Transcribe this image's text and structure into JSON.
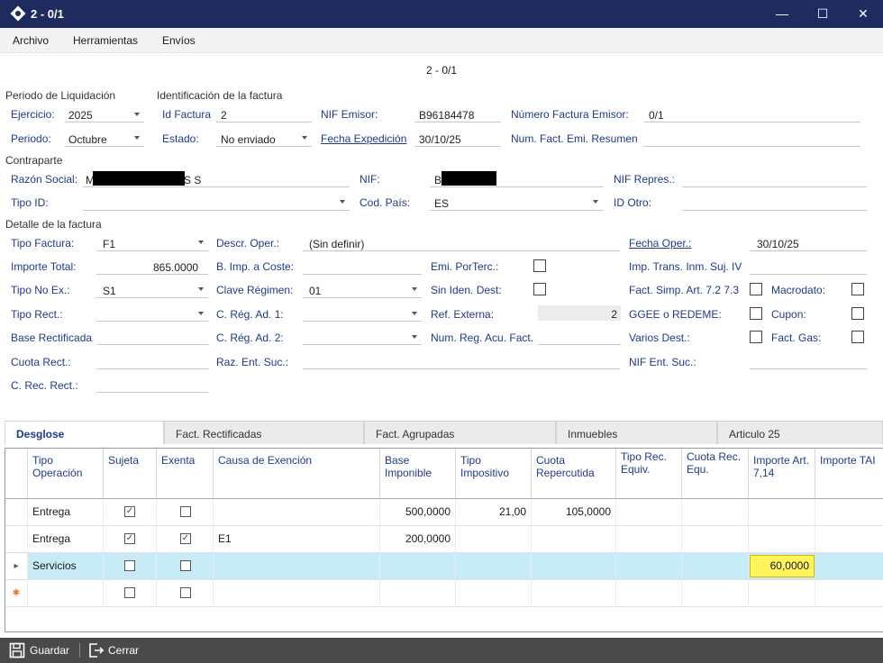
{
  "window": {
    "title": "2 - 0/1",
    "minimize": "—",
    "maximize": "☐",
    "close": "✕"
  },
  "menu": [
    "Archivo",
    "Herramientas",
    "Envíos"
  ],
  "form": {
    "header": "2 - 0/1",
    "sections": {
      "periodo": "Periodo de Liquidación",
      "identificacion": "Identificación de la factura",
      "contraparte": "Contraparte",
      "detalle": "Detalle de la factura"
    },
    "ejercicio": {
      "label": "Ejercicio:",
      "value": "2025"
    },
    "periodo": {
      "label": "Periodo:",
      "value": "Octubre"
    },
    "id_factura": {
      "label": "Id Factura",
      "value": "2"
    },
    "estado": {
      "label": "Estado:",
      "value": "No enviado"
    },
    "nif_emisor": {
      "label": "NIF Emisor:",
      "value": "B96184478"
    },
    "fecha_expedicion": {
      "label": "Fecha Expedición",
      "value": "30/10/25"
    },
    "numero_factura": {
      "label": "Número Factura Emisor:",
      "value": "0/1"
    },
    "num_fact_resumen": {
      "label": "Num. Fact. Emi. Resumen",
      "value": ""
    },
    "razon_social": {
      "label": "Razón Social:",
      "value_start": "M",
      "value_end": "S S"
    },
    "nif": {
      "label": "NIF:",
      "value": "B"
    },
    "nif_repres": {
      "label": "NIF Repres.:",
      "value": ""
    },
    "tipo_id": {
      "label": "Tipo ID:",
      "value": ""
    },
    "cod_pais": {
      "label": "Cod. País:",
      "value": "ES"
    },
    "id_otro": {
      "label": "ID Otro:",
      "value": ""
    },
    "tipo_factura": {
      "label": "Tipo Factura:",
      "value": "F1"
    },
    "descr_oper": {
      "label": "Descr. Oper.:",
      "value": "(Sin definir)"
    },
    "fecha_oper": {
      "label": "Fecha Oper.:",
      "value": "30/10/25"
    },
    "importe_total": {
      "label": "Importe Total:",
      "value": "865.0000"
    },
    "b_imp_coste": {
      "label": "B. Imp. a Coste:",
      "value": ""
    },
    "emi_porterc": {
      "label": "Emi. PorTerc.:"
    },
    "imp_trans": {
      "label": "Imp. Trans. Inm. Suj. IV",
      "value": ""
    },
    "tipo_no_ex": {
      "label": "Tipo No Ex.:",
      "value": "S1"
    },
    "clave_regimen": {
      "label": "Clave Régimen:",
      "value": "01"
    },
    "sin_iden_dest": {
      "label": "Sin Iden. Dest:"
    },
    "fact_simp": {
      "label": "Fact. Simp. Art. 7.2 7.3"
    },
    "macrodato": {
      "label": "Macrodato:"
    },
    "tipo_rect": {
      "label": "Tipo Rect.:",
      "value": ""
    },
    "c_reg_ad1": {
      "label": "C. Rég. Ad. 1:",
      "value": ""
    },
    "ref_externa": {
      "label": "Ref. Externa:",
      "value": "2"
    },
    "ggee": {
      "label": "GGEE o REDEME:"
    },
    "cupon": {
      "label": "Cupon:"
    },
    "base_rectificada": {
      "label": "Base Rectificada",
      "value": ""
    },
    "c_reg_ad2": {
      "label": "C. Rég. Ad. 2:",
      "value": ""
    },
    "num_reg_acu": {
      "label": "Num. Reg. Acu. Fact.",
      "value": ""
    },
    "varios_dest": {
      "label": "Varios Dest.:"
    },
    "fact_gas": {
      "label": "Fact. Gas:"
    },
    "cuota_rect": {
      "label": "Cuota Rect.:",
      "value": ""
    },
    "raz_ent_suc": {
      "label": "Raz. Ent. Suc.:",
      "value": ""
    },
    "nif_ent_suc": {
      "label": "NIF Ent. Suc.:",
      "value": ""
    },
    "c_rec_rect": {
      "label": "C. Rec. Rect.:",
      "value": ""
    }
  },
  "tabs": [
    "Desglose",
    "Fact. Rectificadas",
    "Fact. Agrupadas",
    "Inmuebles",
    "Articulo 25"
  ],
  "grid": {
    "columns": [
      "Tipo Operación",
      "Sujeta",
      "Exenta",
      "Causa de Exención",
      "Base Imponible",
      "Tipo Impositivo",
      "Cuota Repercutida",
      "Tipo Rec. Equiv.",
      "Cuota Rec. Equ.",
      "Importe Art. 7,14",
      "Importe TAI"
    ],
    "rows": [
      {
        "tipo": "Entrega",
        "sujeta": true,
        "exenta": false,
        "causa": "",
        "base": "500,0000",
        "tipo_imp": "21,00",
        "cuota": "105,0000",
        "importe714": ""
      },
      {
        "tipo": "Entrega",
        "sujeta": true,
        "exenta": true,
        "causa": "E1",
        "base": "200,0000",
        "tipo_imp": "",
        "cuota": "",
        "importe714": ""
      },
      {
        "tipo": "Servicios",
        "sujeta": false,
        "exenta": false,
        "causa": "",
        "base": "",
        "tipo_imp": "",
        "cuota": "",
        "importe714": "60,0000"
      },
      {
        "tipo": "",
        "sujeta": false,
        "exenta": false,
        "causa": "",
        "base": "",
        "tipo_imp": "",
        "cuota": "",
        "importe714": ""
      }
    ],
    "row_markers": [
      "",
      "",
      "▸",
      "✱"
    ],
    "check": "✓"
  },
  "footer": {
    "save": "Guardar",
    "close": "Cerrar"
  },
  "colors": {
    "titlebar": "#1f2b5e",
    "label": "#1f3a8a",
    "selected_row": "#c8ecf7",
    "highlight": "#fff45c"
  }
}
